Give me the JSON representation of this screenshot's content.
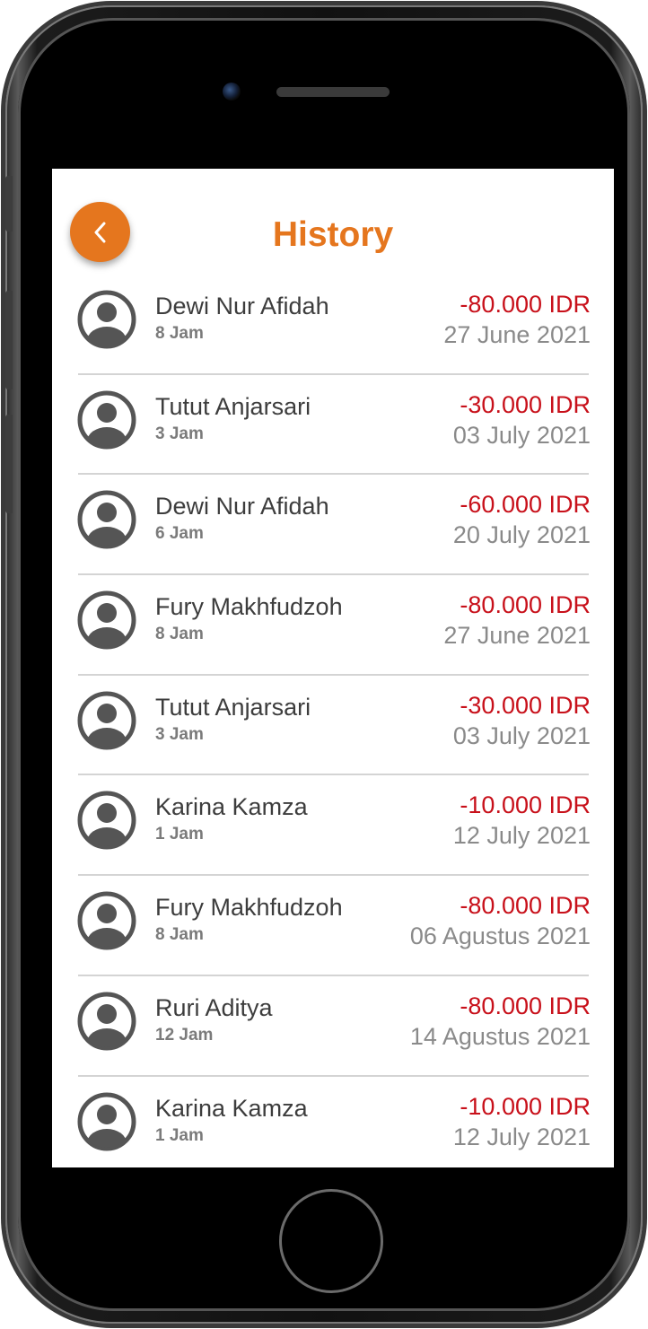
{
  "header": {
    "title": "History"
  },
  "colors": {
    "accent": "#e5761e",
    "amount": "#c8101a",
    "text": "#3d3d3d",
    "muted": "#8a8a8a"
  },
  "icons": {
    "back": "chevron-left-icon",
    "avatar": "user-avatar-icon",
    "home": "home-button"
  },
  "transactions": [
    {
      "name": "Dewi Nur Afidah",
      "ago": "8 Jam",
      "amount": "-80.000 IDR",
      "date": "27 June 2021"
    },
    {
      "name": "Tutut Anjarsari",
      "ago": "3 Jam",
      "amount": "-30.000 IDR",
      "date": "03 July 2021"
    },
    {
      "name": "Dewi Nur Afidah",
      "ago": "6 Jam",
      "amount": "-60.000 IDR",
      "date": "20 July 2021"
    },
    {
      "name": "Fury Makhfudzoh",
      "ago": "8 Jam",
      "amount": "-80.000 IDR",
      "date": "27 June 2021"
    },
    {
      "name": "Tutut Anjarsari",
      "ago": "3 Jam",
      "amount": "-30.000 IDR",
      "date": "03 July 2021"
    },
    {
      "name": "Karina Kamza",
      "ago": "1 Jam",
      "amount": "-10.000 IDR",
      "date": "12 July 2021"
    },
    {
      "name": "Fury Makhfudzoh",
      "ago": "8 Jam",
      "amount": "-80.000 IDR",
      "date": "06 Agustus 2021"
    },
    {
      "name": "Ruri Aditya",
      "ago": "12 Jam",
      "amount": "-80.000 IDR",
      "date": "14 Agustus 2021"
    },
    {
      "name": "Karina Kamza",
      "ago": "1 Jam",
      "amount": "-10.000 IDR",
      "date": "12 July 2021"
    }
  ]
}
